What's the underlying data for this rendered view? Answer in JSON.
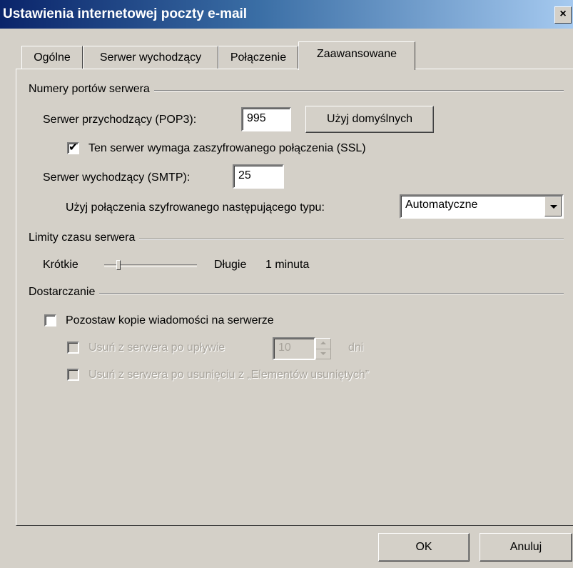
{
  "window": {
    "title": "Ustawienia internetowej poczty e-mail",
    "close_glyph": "×"
  },
  "tabs": [
    {
      "label": "Ogólne",
      "active": false
    },
    {
      "label": "Serwer wychodzący",
      "active": false
    },
    {
      "label": "Połączenie",
      "active": false
    },
    {
      "label": "Zaawansowane",
      "active": true
    }
  ],
  "ports": {
    "group_label": "Numery portów serwera",
    "incoming_label": "Serwer przychodzący (POP3):",
    "incoming_value": "995",
    "use_defaults_label": "Użyj domyślnych",
    "ssl_checked": true,
    "ssl_label": "Ten serwer wymaga zaszyfrowanego połączenia (SSL)",
    "outgoing_label": "Serwer wychodzący (SMTP):",
    "outgoing_value": "25",
    "encryption_label": "Użyj połączenia szyfrowanego następującego typu:",
    "encryption_value": "Automatyczne"
  },
  "timeouts": {
    "group_label": "Limity czasu serwera",
    "short_label": "Krótkie",
    "long_label": "Długie",
    "value_label": "1 minuta",
    "slider_level": 0.15
  },
  "delivery": {
    "group_label": "Dostarczanie",
    "leave_copy_label": "Pozostaw kopie wiadomości na serwerze",
    "leave_copy_checked": false,
    "remove_after_label": "Usuń z serwera po upływie",
    "remove_after_value": "10",
    "days_label": "dni",
    "remove_deleted_label": "Usuń z serwera po usunięciu z „Elementów usuniętych”"
  },
  "buttons": {
    "ok_label": "OK",
    "cancel_label": "Anuluj"
  },
  "colors": {
    "title_gradient_start": "#0a246a",
    "title_gradient_end": "#a6caf0",
    "face": "#d4d0c8",
    "disabled_text": "#a8a49c"
  }
}
